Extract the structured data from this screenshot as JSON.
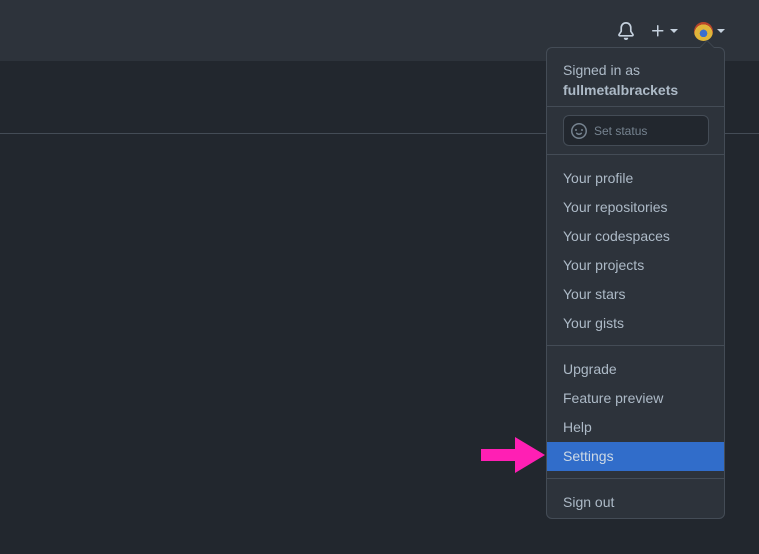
{
  "header": {
    "notifications_icon": "bell-icon",
    "create_icon": "plus-icon",
    "avatar_icon": "avatar"
  },
  "menu": {
    "signed_in_label": "Signed in as",
    "username": "fullmetalbrackets",
    "status_placeholder": "Set status",
    "group1": [
      "Your profile",
      "Your repositories",
      "Your codespaces",
      "Your projects",
      "Your stars",
      "Your gists"
    ],
    "group2": [
      "Upgrade",
      "Feature preview",
      "Help",
      "Settings"
    ],
    "sign_out": "Sign out",
    "active_item": "Settings"
  },
  "annotation": {
    "arrow_color": "#ff1fb4"
  },
  "colors": {
    "background": "#22272e",
    "header": "#2d333b",
    "highlight": "#316dca"
  }
}
